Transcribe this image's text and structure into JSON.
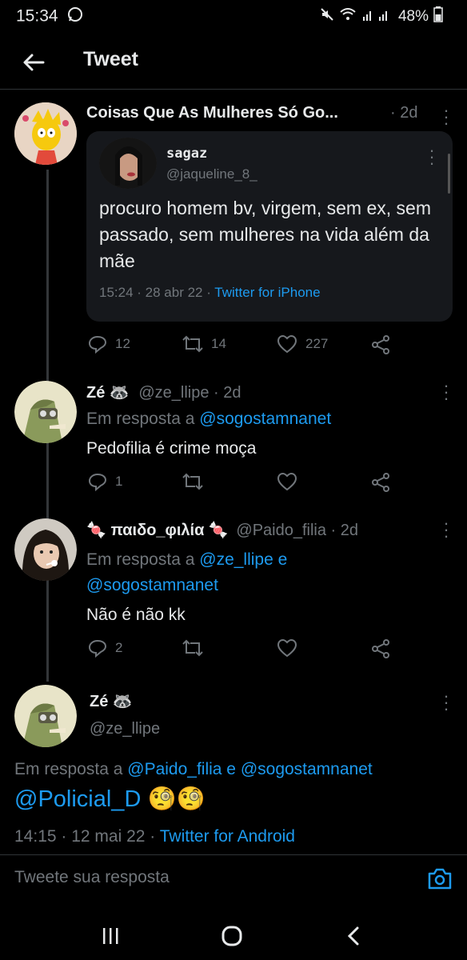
{
  "status_bar": {
    "time": "15:34",
    "battery": "48%",
    "whatsapp_icon": "whatsapp-icon",
    "mute_icon": "mute-icon",
    "wifi_icon": "wifi-icon",
    "signal_icon": "signal-icon",
    "battery_icon": "battery-icon"
  },
  "header": {
    "title": "Tweet",
    "back_icon": "arrow-left-icon"
  },
  "tweet1": {
    "name": "Coisas Que As Mulheres Só Go...",
    "time": "· 2d",
    "quote": {
      "name": "sagaz",
      "handle": "@jaqueline_8_",
      "text": "procuro homem bv, virgem, sem ex, sem passado, sem mulheres na vida além da mãe",
      "meta_time": "15:24 · 28 abr 22 ·",
      "meta_source": "Twitter for iPhone"
    },
    "replies": "12",
    "retweets": "14",
    "likes": "227"
  },
  "tweet2": {
    "name": "Zé 🦝",
    "handle": "@ze_llipe · 2d",
    "reply_prefix": "Em resposta a",
    "reply_to": "@sogostamnanet",
    "text": "Pedofilia é crime moça",
    "replies": "1"
  },
  "tweet3": {
    "name": "🍬 παιδο_φιλία 🍬",
    "handle": "@Paido_filia · 2d",
    "reply_prefix": "Em resposta a",
    "reply_to_1": "@ze_llipe e",
    "reply_to_2": "@sogostamnanet",
    "text": "Não é não kk",
    "replies": "2"
  },
  "tweet4": {
    "name": "Zé 🦝",
    "handle": "@ze_llipe",
    "reply_prefix": "Em resposta a",
    "reply_to": "@Paido_filia e @sogostamnanet",
    "mention": "@Policial_D",
    "emoji": "🧐🧐",
    "timestamp": "14:15 · 12 mai 22 ·",
    "source": "Twitter for Android"
  },
  "composer": {
    "placeholder": "Tweete sua resposta",
    "camera_icon": "camera-icon"
  },
  "navbar": {
    "recent_icon": "recent-apps-icon",
    "home_icon": "home-icon",
    "back_icon": "nav-back-icon"
  },
  "colors": {
    "background": "#000000",
    "text": "#e7e9ea",
    "muted": "#71767b",
    "link": "#1d9bf0",
    "card": "#16181c"
  }
}
